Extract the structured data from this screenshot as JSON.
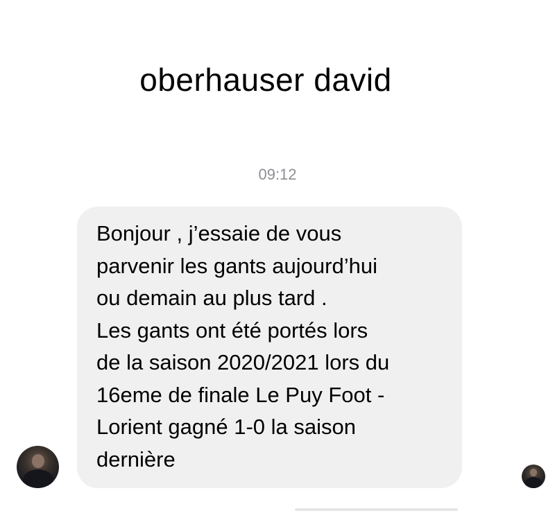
{
  "header": {
    "contact_name": "oberhauser david"
  },
  "conversation": {
    "timestamp": "09:12",
    "message": {
      "lines": [
        "Bonjour , j’essaie de vous",
        "parvenir les gants aujourd’hui",
        "ou demain au plus tard .",
        "Les gants ont été portés lors",
        "de la saison 2020/2021 lors du",
        "16eme de finale Le Puy Foot -",
        "Lorient gagné 1-0 la saison",
        "dernière"
      ]
    }
  },
  "icons": {
    "sender_avatar": "avatar-photo",
    "read_receipt_avatar": "avatar-photo"
  },
  "colors": {
    "bubble_background": "#f0f0f0",
    "timestamp_text": "#8e8e93",
    "text": "#000000"
  }
}
